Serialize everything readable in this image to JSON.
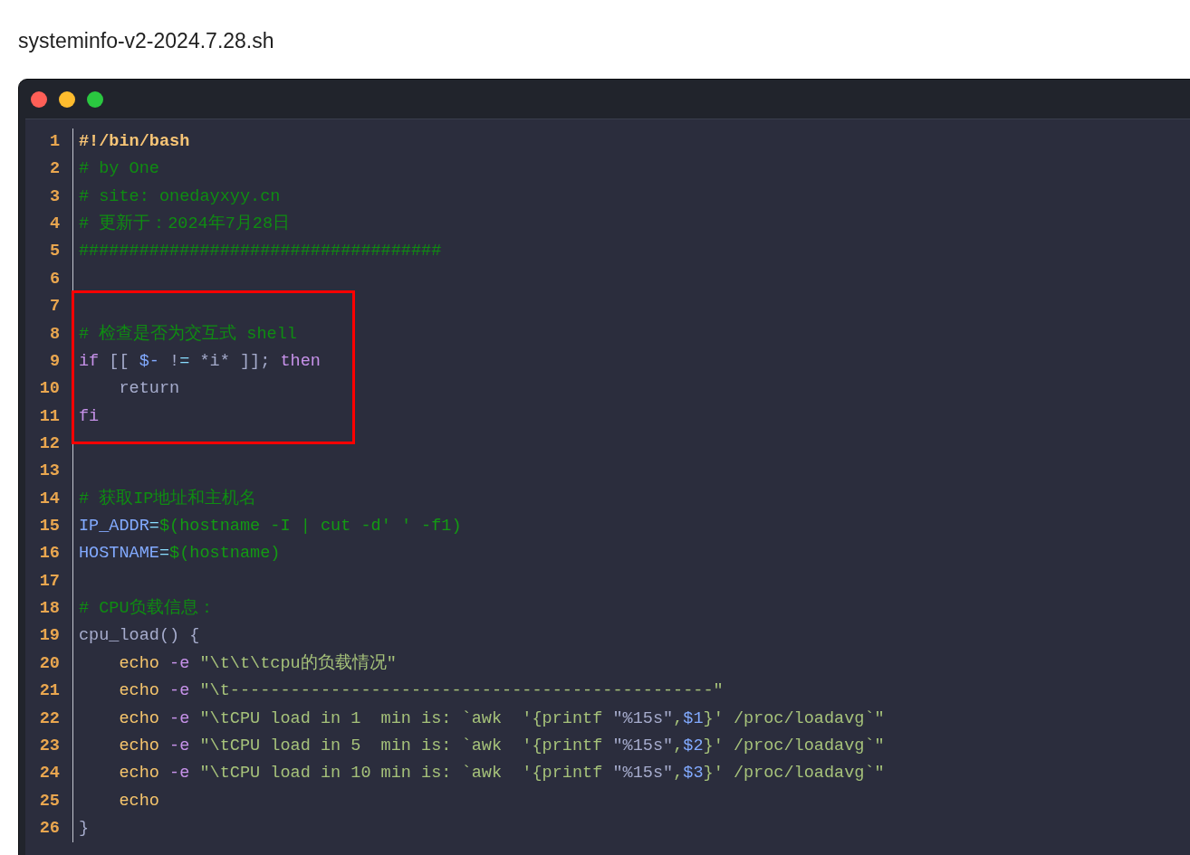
{
  "file_name": "systeminfo-v2-2024.7.28.sh",
  "window_controls": [
    {
      "color": "#fe5f57"
    },
    {
      "color": "#febc2e"
    },
    {
      "color": "#2ac840"
    }
  ],
  "code": {
    "lines": [
      {
        "number": "1",
        "boxed": false,
        "tokens": [
          {
            "kind": "shebang",
            "text": "#!/bin/bash"
          }
        ]
      },
      {
        "number": "2",
        "boxed": false,
        "tokens": [
          {
            "kind": "comment",
            "text": "# by One"
          }
        ]
      },
      {
        "number": "3",
        "boxed": false,
        "tokens": [
          {
            "kind": "comment",
            "text": "# site: onedayxyy.cn"
          }
        ]
      },
      {
        "number": "4",
        "boxed": false,
        "tokens": [
          {
            "kind": "comment",
            "text": "# 更新于：2024年7月28日"
          }
        ]
      },
      {
        "number": "5",
        "boxed": false,
        "tokens": [
          {
            "kind": "comment",
            "text": "####################################"
          }
        ]
      },
      {
        "number": "6",
        "boxed": false
      },
      {
        "number": "7",
        "boxed": true
      },
      {
        "number": "8",
        "boxed": true,
        "tokens": [
          {
            "kind": "comment",
            "text": "# 检查是否为交互式 shell"
          }
        ]
      },
      {
        "number": "9",
        "boxed": true,
        "tokens": [
          {
            "kind": "keyword",
            "text": "if"
          },
          {
            "kind": "plain",
            "text": " [[ "
          },
          {
            "kind": "variable",
            "text": "$-"
          },
          {
            "kind": "plain",
            "text": " !"
          },
          {
            "kind": "operator",
            "text": "="
          },
          {
            "kind": "plain",
            "text": " *i* ]]; "
          },
          {
            "kind": "keyword",
            "text": "then"
          }
        ]
      },
      {
        "number": "10",
        "boxed": true,
        "tokens": [
          {
            "kind": "plain",
            "text": "    return"
          }
        ]
      },
      {
        "number": "11",
        "boxed": true,
        "tokens": [
          {
            "kind": "keyword",
            "text": "fi"
          }
        ]
      },
      {
        "number": "12",
        "boxed": false
      },
      {
        "number": "13",
        "boxed": false
      },
      {
        "number": "14",
        "boxed": false,
        "tokens": [
          {
            "kind": "comment",
            "text": "# 获取IP地址和主机名"
          }
        ]
      },
      {
        "number": "15",
        "boxed": false,
        "tokens": [
          {
            "kind": "variable",
            "text": "IP_ADDR"
          },
          {
            "kind": "operator",
            "text": "="
          },
          {
            "kind": "subst",
            "text": "$(hostname -I | cut -d' ' -f1)"
          }
        ]
      },
      {
        "number": "16",
        "boxed": false,
        "tokens": [
          {
            "kind": "variable",
            "text": "HOSTNAME"
          },
          {
            "kind": "operator",
            "text": "="
          },
          {
            "kind": "subst",
            "text": "$(hostname)"
          }
        ]
      },
      {
        "number": "17",
        "boxed": false
      },
      {
        "number": "18",
        "boxed": false,
        "tokens": [
          {
            "kind": "comment",
            "text": "# CPU负载信息："
          }
        ]
      },
      {
        "number": "19",
        "boxed": false,
        "tokens": [
          {
            "kind": "plain",
            "text": "cpu_load() {"
          }
        ]
      },
      {
        "number": "20",
        "boxed": false,
        "tokens": [
          {
            "kind": "builtin",
            "text": "    echo"
          },
          {
            "kind": "flag",
            "text": " -e "
          },
          {
            "kind": "string",
            "text": "\"\\t\\t\\tcpu的负载情况\""
          }
        ]
      },
      {
        "number": "21",
        "boxed": false,
        "tokens": [
          {
            "kind": "builtin",
            "text": "    echo"
          },
          {
            "kind": "flag",
            "text": " -e "
          },
          {
            "kind": "string",
            "text": "\"\\t------------------------------------------------\""
          }
        ]
      },
      {
        "number": "22",
        "boxed": false,
        "tokens": [
          {
            "kind": "builtin",
            "text": "    echo"
          },
          {
            "kind": "flag",
            "text": " -e "
          },
          {
            "kind": "string",
            "text": "\"\\tCPU load in 1  min is: `awk  '{printf "
          },
          {
            "kind": "format",
            "text": "\"%15s\""
          },
          {
            "kind": "string",
            "text": ","
          },
          {
            "kind": "variable",
            "text": "$1"
          },
          {
            "kind": "string",
            "text": "}' /proc/loadavg`\""
          }
        ]
      },
      {
        "number": "23",
        "boxed": false,
        "tokens": [
          {
            "kind": "builtin",
            "text": "    echo"
          },
          {
            "kind": "flag",
            "text": " -e "
          },
          {
            "kind": "string",
            "text": "\"\\tCPU load in 5  min is: `awk  '{printf "
          },
          {
            "kind": "format",
            "text": "\"%15s\""
          },
          {
            "kind": "string",
            "text": ","
          },
          {
            "kind": "variable",
            "text": "$2"
          },
          {
            "kind": "string",
            "text": "}' /proc/loadavg`\""
          }
        ]
      },
      {
        "number": "24",
        "boxed": false,
        "tokens": [
          {
            "kind": "builtin",
            "text": "    echo"
          },
          {
            "kind": "flag",
            "text": " -e "
          },
          {
            "kind": "string",
            "text": "\"\\tCPU load in 10 min is: `awk  '{printf "
          },
          {
            "kind": "format",
            "text": "\"%15s\""
          },
          {
            "kind": "string",
            "text": ","
          },
          {
            "kind": "variable",
            "text": "$3"
          },
          {
            "kind": "string",
            "text": "}' /proc/loadavg`\""
          }
        ]
      },
      {
        "number": "25",
        "boxed": false,
        "tokens": [
          {
            "kind": "builtin",
            "text": "    echo"
          }
        ]
      },
      {
        "number": "26",
        "boxed": false,
        "tokens": [
          {
            "kind": "plain",
            "text": "}"
          }
        ]
      }
    ]
  }
}
